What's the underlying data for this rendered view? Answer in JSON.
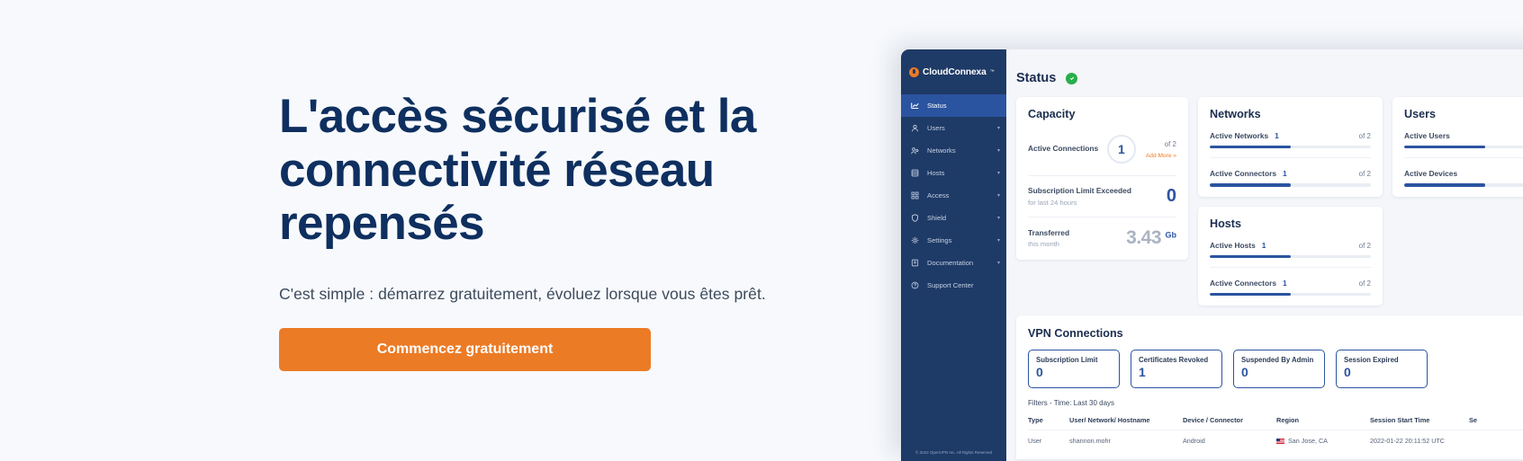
{
  "hero": {
    "title": "L'accès sécurisé et la connectivité réseau repensés",
    "subtitle": "C'est simple : démarrez gratuitement, évoluez lorsque vous êtes prêt.",
    "cta_label": "Commencez gratuitement",
    "accent_orange": "#ec7b26",
    "title_color": "#0e2f5f"
  },
  "app": {
    "brand": {
      "name": "CloudConnexa",
      "tm": "™"
    },
    "sidebar": {
      "items": [
        {
          "label": "Status",
          "icon": "chart-icon",
          "active": true,
          "caret": false
        },
        {
          "label": "Users",
          "icon": "user-icon",
          "active": false,
          "caret": true
        },
        {
          "label": "Networks",
          "icon": "network-icon",
          "active": false,
          "caret": true
        },
        {
          "label": "Hosts",
          "icon": "server-icon",
          "active": false,
          "caret": true
        },
        {
          "label": "Access",
          "icon": "grid-icon",
          "active": false,
          "caret": true
        },
        {
          "label": "Shield",
          "icon": "shield-icon",
          "active": false,
          "caret": true
        },
        {
          "label": "Settings",
          "icon": "gear-icon",
          "active": false,
          "caret": true
        },
        {
          "label": "Documentation",
          "icon": "document-icon",
          "active": false,
          "caret": true
        },
        {
          "label": "Support Center",
          "icon": "help-circle-icon",
          "active": false,
          "caret": false
        }
      ],
      "footer": "© 2022 OpenVPN Inc. All Rights Reserved"
    },
    "header": {
      "title": "Status",
      "badge_icon": "check-shield-icon",
      "badge_color": "#27ae4a"
    },
    "capacity": {
      "title": "Capacity",
      "active_connections_label": "Active Connections",
      "active_connections_value": "1",
      "active_connections_of": "of 2",
      "add_more_label": "Add More »",
      "subscription_label": "Subscription Limit Exceeded",
      "subscription_sub": "for last 24 hours",
      "subscription_value": "0",
      "transferred_label": "Transferred",
      "transferred_sub": "this month",
      "transferred_value": "3.43",
      "transferred_unit": "Gb"
    },
    "networks": {
      "title": "Networks",
      "rows": [
        {
          "label": "Active Networks",
          "value": "1",
          "of": "of 2",
          "pct": 50
        },
        {
          "label": "Active Connectors",
          "value": "1",
          "of": "of 2",
          "pct": 50
        }
      ]
    },
    "hosts": {
      "title": "Hosts",
      "rows": [
        {
          "label": "Active Hosts",
          "value": "1",
          "of": "of 2",
          "pct": 50
        },
        {
          "label": "Active Connectors",
          "value": "1",
          "of": "of 2",
          "pct": 50
        }
      ]
    },
    "users": {
      "title": "Users",
      "rows": [
        {
          "label": "Active Users",
          "value": "",
          "of": "",
          "pct": 50
        },
        {
          "label": "Active Devices",
          "value": "",
          "of": "",
          "pct": 50
        }
      ]
    },
    "vpn": {
      "title": "VPN Connections",
      "boxes": [
        {
          "label": "Subscription Limit",
          "value": "0"
        },
        {
          "label": "Certificates Revoked",
          "value": "1"
        },
        {
          "label": "Suspended By Admin",
          "value": "0"
        },
        {
          "label": "Session Expired",
          "value": "0"
        }
      ],
      "filters": "Filters - Time: Last 30 days",
      "columns": [
        "Type",
        "User/ Network/ Hostname",
        "Device / Connector",
        "Region",
        "Session Start Time",
        "Se"
      ],
      "rows": [
        {
          "type": "User",
          "user": "shannon.mohr",
          "device": "Android",
          "region": "San Jose, CA",
          "region_flag": "us-flag-icon",
          "session_start": "2022-01-22 20:11:52  UTC",
          "last": ""
        }
      ]
    }
  }
}
